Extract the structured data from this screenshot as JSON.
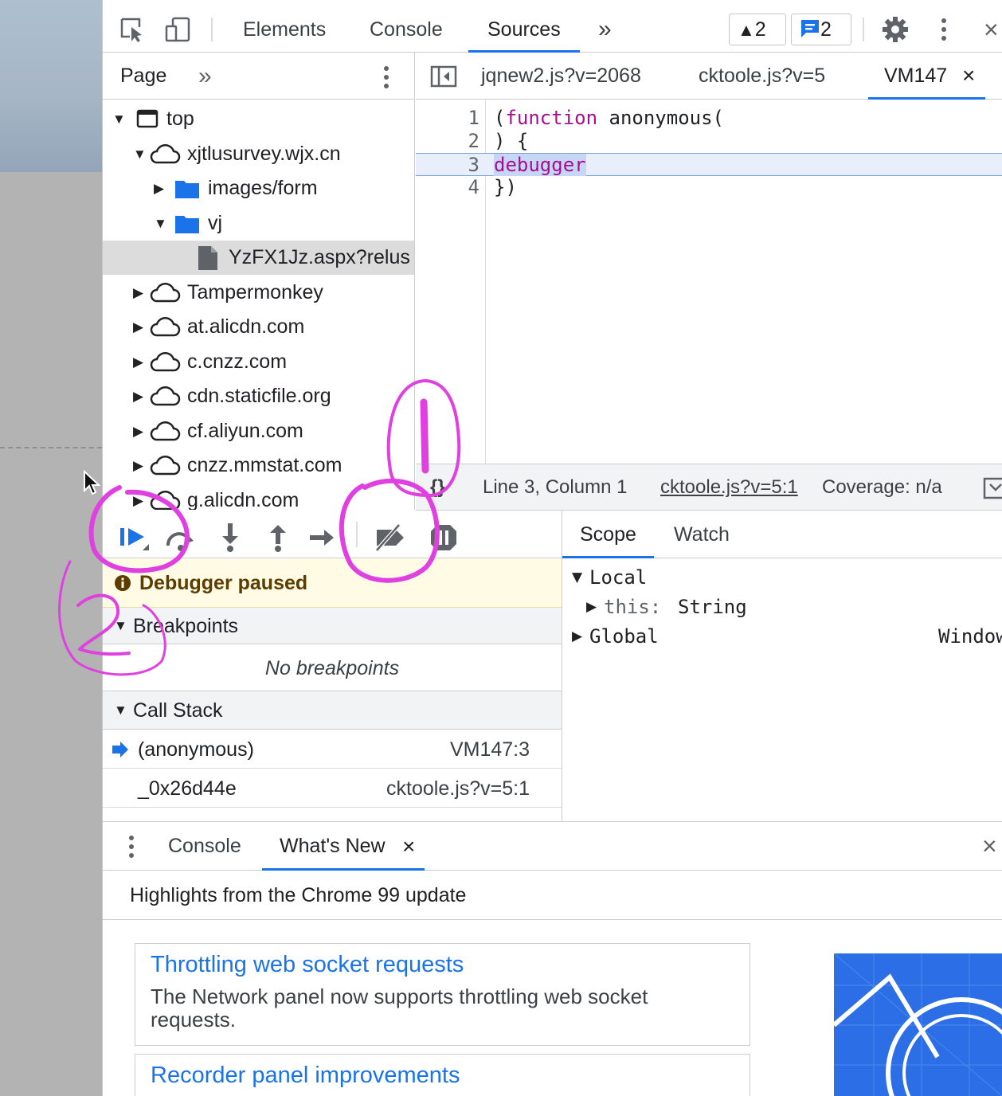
{
  "toolbar": {
    "tabs": [
      "Elements",
      "Console",
      "Sources"
    ],
    "more": "»",
    "warnings": "2",
    "messages": "2",
    "close": "×"
  },
  "navigator": {
    "tab": "Page",
    "more": "»",
    "tree": [
      {
        "label": "top"
      },
      {
        "label": "xjtlusurvey.wjx.cn"
      },
      {
        "label": "images/form"
      },
      {
        "label": "vj"
      },
      {
        "label": "YzFX1Jz.aspx?relus"
      },
      {
        "label": "Tampermonkey"
      },
      {
        "label": "at.alicdn.com"
      },
      {
        "label": "c.cnzz.com"
      },
      {
        "label": "cdn.staticfile.org"
      },
      {
        "label": "cf.aliyun.com"
      },
      {
        "label": "cnzz.mmstat.com"
      },
      {
        "label": "g.alicdn.com"
      }
    ]
  },
  "editor": {
    "tabs": [
      "jqnew2.js?v=2068",
      "cktoole.js?v=5",
      "VM147"
    ],
    "close": "×",
    "lines": [
      {
        "num": "1",
        "pre": "(",
        "kw": "function",
        "post": " anonymous("
      },
      {
        "num": "2",
        "text": ") {"
      },
      {
        "num": "3",
        "dbg": "debugger"
      },
      {
        "num": "4",
        "text": "})"
      }
    ],
    "status": {
      "braces": "{}",
      "position": "Line 3, Column 1",
      "source": "cktoole.js?v=5:1",
      "coverage": "Coverage: n/a"
    }
  },
  "debugger": {
    "paused": "Debugger paused",
    "breakpoints_title": "Breakpoints",
    "no_breakpoints": "No breakpoints",
    "callstack_title": "Call Stack",
    "frames": [
      {
        "fn": "(anonymous)",
        "loc": "VM147:3"
      },
      {
        "fn": "_0x26d44e",
        "loc": "cktoole.js?v=5:1"
      }
    ]
  },
  "scope": {
    "tabs": [
      "Scope",
      "Watch"
    ],
    "local": "Local",
    "this_key": "this:",
    "this_val": "String",
    "global": "Global",
    "global_val": "Window"
  },
  "drawer": {
    "tabs": [
      "Console",
      "What's New"
    ],
    "close": "×",
    "highlights": "Highlights from the Chrome 99 update",
    "cards": [
      {
        "title": "Throttling web socket requests",
        "desc": "The Network panel now supports throttling web socket requests."
      },
      {
        "title": "Recorder panel improvements",
        "desc": ""
      }
    ]
  },
  "annotations": {
    "one": "1",
    "two": "2"
  },
  "colors": {
    "accent": "#1a73e8",
    "annotation": "#e040e0",
    "paused_bg": "#fffbe5"
  }
}
